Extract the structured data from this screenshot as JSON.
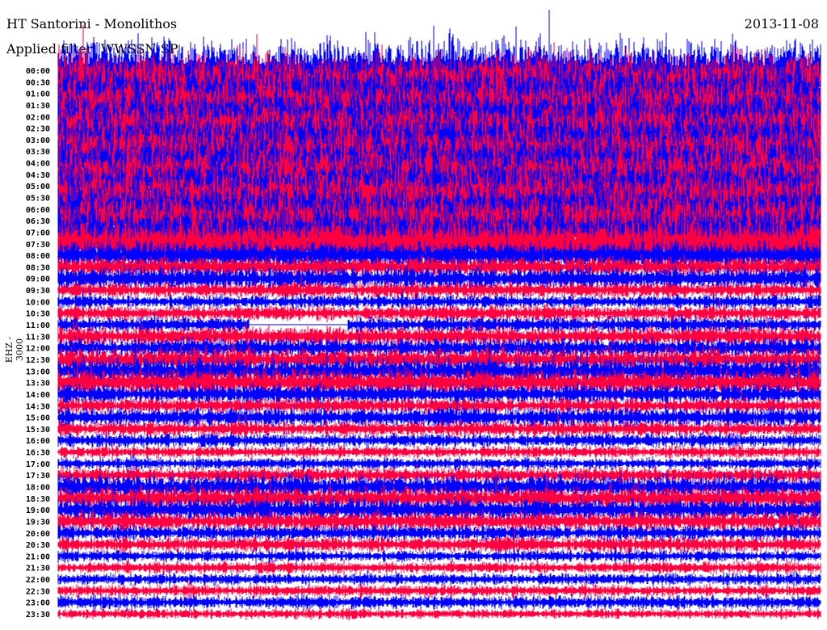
{
  "header": {
    "title": "HT Santorini - Monolithos",
    "filter": "Applied filter: WWSSN-SP",
    "date": "2013-11-08",
    "channel": "EHZ - 3000"
  },
  "chart_data": {
    "type": "line",
    "title": "HT Santorini - Monolithos",
    "subtitle": "Applied filter: WWSSN-SP",
    "ylabel": "EHZ - 3000",
    "colors": [
      "#0000ff",
      "#ff0040"
    ],
    "row_labels": [
      "00:00",
      "00:30",
      "01:00",
      "01:30",
      "02:00",
      "02:30",
      "03:00",
      "03:30",
      "04:00",
      "04:30",
      "05:00",
      "05:30",
      "06:00",
      "06:30",
      "07:00",
      "07:30",
      "08:00",
      "08:30",
      "09:00",
      "09:30",
      "10:00",
      "10:30",
      "11:00",
      "11:30",
      "12:00",
      "12:30",
      "13:00",
      "13:30",
      "14:00",
      "14:30",
      "15:00",
      "15:30",
      "16:00",
      "16:30",
      "17:00",
      "17:30",
      "18:00",
      "18:30",
      "19:00",
      "19:30",
      "20:00",
      "20:30",
      "21:00",
      "21:30",
      "22:00",
      "22:30",
      "23:00",
      "23:30"
    ],
    "relative_amplitude": [
      30,
      30,
      30,
      30,
      30,
      30,
      30,
      29,
      30,
      30,
      30,
      29,
      28,
      28,
      28,
      27,
      15,
      10,
      12,
      8,
      7,
      8,
      8,
      10,
      10,
      12,
      14,
      14,
      10,
      8,
      10,
      8,
      7,
      6,
      6,
      8,
      12,
      12,
      12,
      10,
      8,
      8,
      6,
      6,
      6,
      6,
      7,
      5
    ],
    "gaps": [
      {
        "row": "11:00",
        "start_fraction": 0.25,
        "end_fraction": 0.38
      }
    ]
  }
}
